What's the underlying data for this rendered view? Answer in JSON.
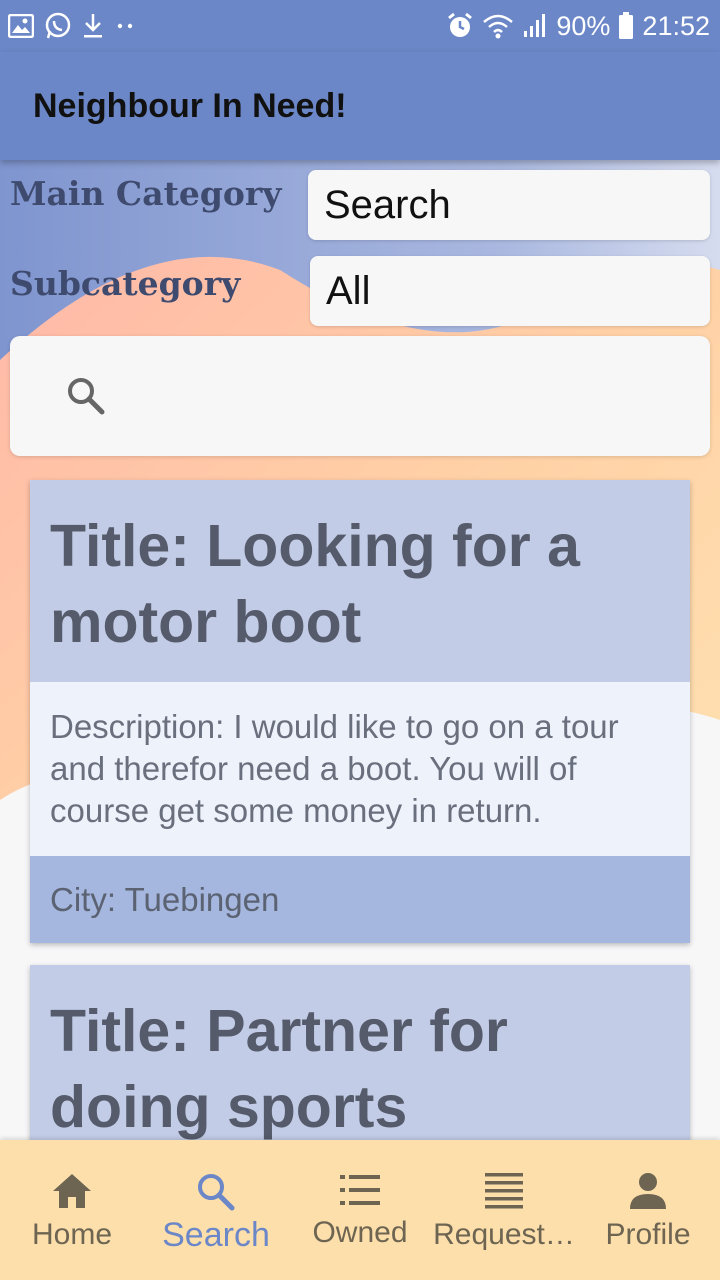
{
  "status_bar": {
    "battery": "90%",
    "time": "21:52",
    "left_icons": [
      "gallery-icon",
      "whatsapp-icon",
      "download-icon",
      "more-dots-icon"
    ],
    "right_icons": [
      "alarm-icon",
      "wifi-icon",
      "signal-icon",
      "battery-icon"
    ]
  },
  "app_bar": {
    "title": "Neighbour In Need!"
  },
  "filters": {
    "main_category_label": "Main Category",
    "main_category_value": "Search",
    "subcategory_label": "Subcategory",
    "subcategory_value": "All"
  },
  "search": {
    "placeholder": "",
    "value": ""
  },
  "cards": [
    {
      "title": "Title: Looking for a motor boot",
      "description": "Description: I would like to go on a tour and therefor need a boot. You will of course get some money in return.",
      "city": "City: Tuebingen"
    },
    {
      "title": "Title: Partner for doing sports"
    }
  ],
  "bottom_nav": {
    "items": [
      {
        "label": "Home",
        "icon": "home-icon"
      },
      {
        "label": "Search",
        "icon": "search-icon",
        "active": true
      },
      {
        "label": "Owned",
        "icon": "list-icon"
      },
      {
        "label": "Request…",
        "icon": "requests-icon"
      },
      {
        "label": "Profile",
        "icon": "person-icon"
      }
    ]
  },
  "colors": {
    "primary": "#6b87c7",
    "card_title_bg": "#c2cce7",
    "card_desc_bg": "#eef2fb",
    "card_city_bg": "#a5b7df",
    "bottom_nav_bg": "#fddfab"
  }
}
